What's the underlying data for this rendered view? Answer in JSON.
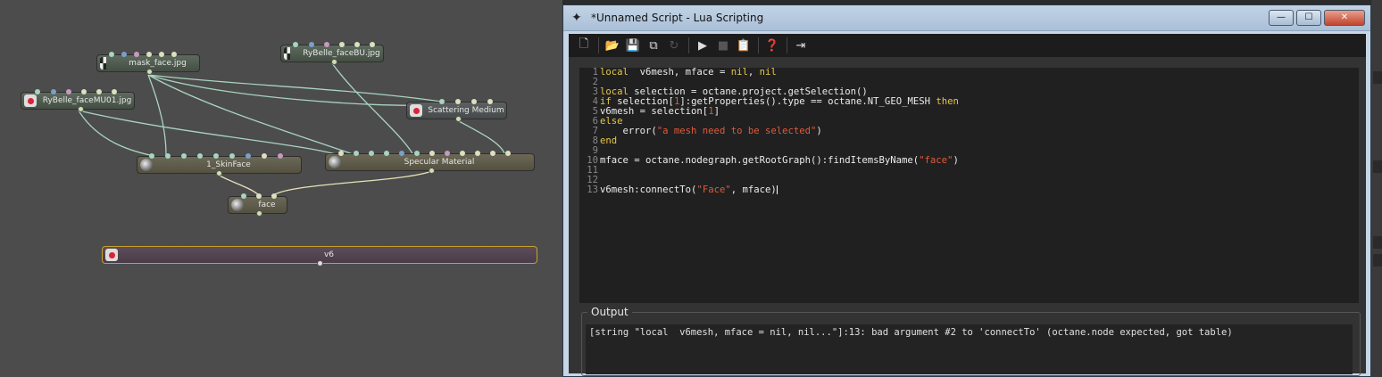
{
  "graph": {
    "nodes": {
      "mask_face": "mask_face.jpg",
      "rybelle_facebu": "RyBelle_faceBU.jpg",
      "rybelle_facemu01": "RyBelle_faceMU01.jpg",
      "scattering_medium": "Scattering Medium",
      "skinface": "1_SkinFace",
      "specular": "Specular Material",
      "face": "face",
      "v6": "v6"
    }
  },
  "window": {
    "title": "*Unnamed Script - Lua Scripting",
    "app_icon": "octane-logo-icon",
    "caption_buttons": {
      "minimize": "—",
      "maximize": "☐",
      "close": "✕"
    }
  },
  "toolbar": {
    "icons": [
      "new-file-icon",
      "open-file-icon",
      "save-icon",
      "save-as-icon",
      "reload-icon",
      "run-icon",
      "stop-icon",
      "paste-icon",
      "help-icon",
      "exit-icon"
    ]
  },
  "editor": {
    "lines": [
      {
        "n": "1",
        "segments": [
          {
            "t": "local",
            "c": "kw"
          },
          {
            "t": "  v6mesh, mface = ",
            "c": "code"
          },
          {
            "t": "nil",
            "c": "kw"
          },
          {
            "t": ", ",
            "c": "code"
          },
          {
            "t": "nil",
            "c": "kw"
          }
        ]
      },
      {
        "n": "2",
        "segments": []
      },
      {
        "n": "3",
        "segments": [
          {
            "t": "local",
            "c": "kw"
          },
          {
            "t": " selection = octane.project.getSelection()",
            "c": "code"
          }
        ]
      },
      {
        "n": "4",
        "segments": [
          {
            "t": "if",
            "c": "kw"
          },
          {
            "t": " selection[",
            "c": "code"
          },
          {
            "t": "1",
            "c": "num"
          },
          {
            "t": "]:getProperties().type == octane.NT_GEO_MESH ",
            "c": "code"
          },
          {
            "t": "then",
            "c": "kw"
          }
        ]
      },
      {
        "n": "5",
        "segments": [
          {
            "t": "v6mesh = selection[",
            "c": "code"
          },
          {
            "t": "1",
            "c": "num"
          },
          {
            "t": "]",
            "c": "code"
          }
        ]
      },
      {
        "n": "6",
        "segments": [
          {
            "t": "else",
            "c": "kw"
          }
        ]
      },
      {
        "n": "7",
        "segments": [
          {
            "t": "    error(",
            "c": "code"
          },
          {
            "t": "\"a mesh need to be selected\"",
            "c": "str"
          },
          {
            "t": ")",
            "c": "code"
          }
        ]
      },
      {
        "n": "8",
        "segments": [
          {
            "t": "end",
            "c": "kw"
          }
        ]
      },
      {
        "n": "9",
        "segments": []
      },
      {
        "n": "10",
        "segments": [
          {
            "t": "mface = octane.nodegraph.getRootGraph():findItemsByName(",
            "c": "code"
          },
          {
            "t": "\"face\"",
            "c": "str"
          },
          {
            "t": ")",
            "c": "code"
          }
        ]
      },
      {
        "n": "11",
        "segments": []
      },
      {
        "n": "12",
        "segments": []
      },
      {
        "n": "13",
        "segments": [
          {
            "t": "v6mesh:connectTo(",
            "c": "code"
          },
          {
            "t": "\"Face\"",
            "c": "str"
          },
          {
            "t": ", mface)",
            "c": "code"
          }
        ]
      }
    ]
  },
  "output": {
    "label": "Output",
    "text": "[string \"local  v6mesh, mface = nil, nil...\"]:13: bad argument #2 to 'connectTo' (octane.node expected, got table)"
  }
}
